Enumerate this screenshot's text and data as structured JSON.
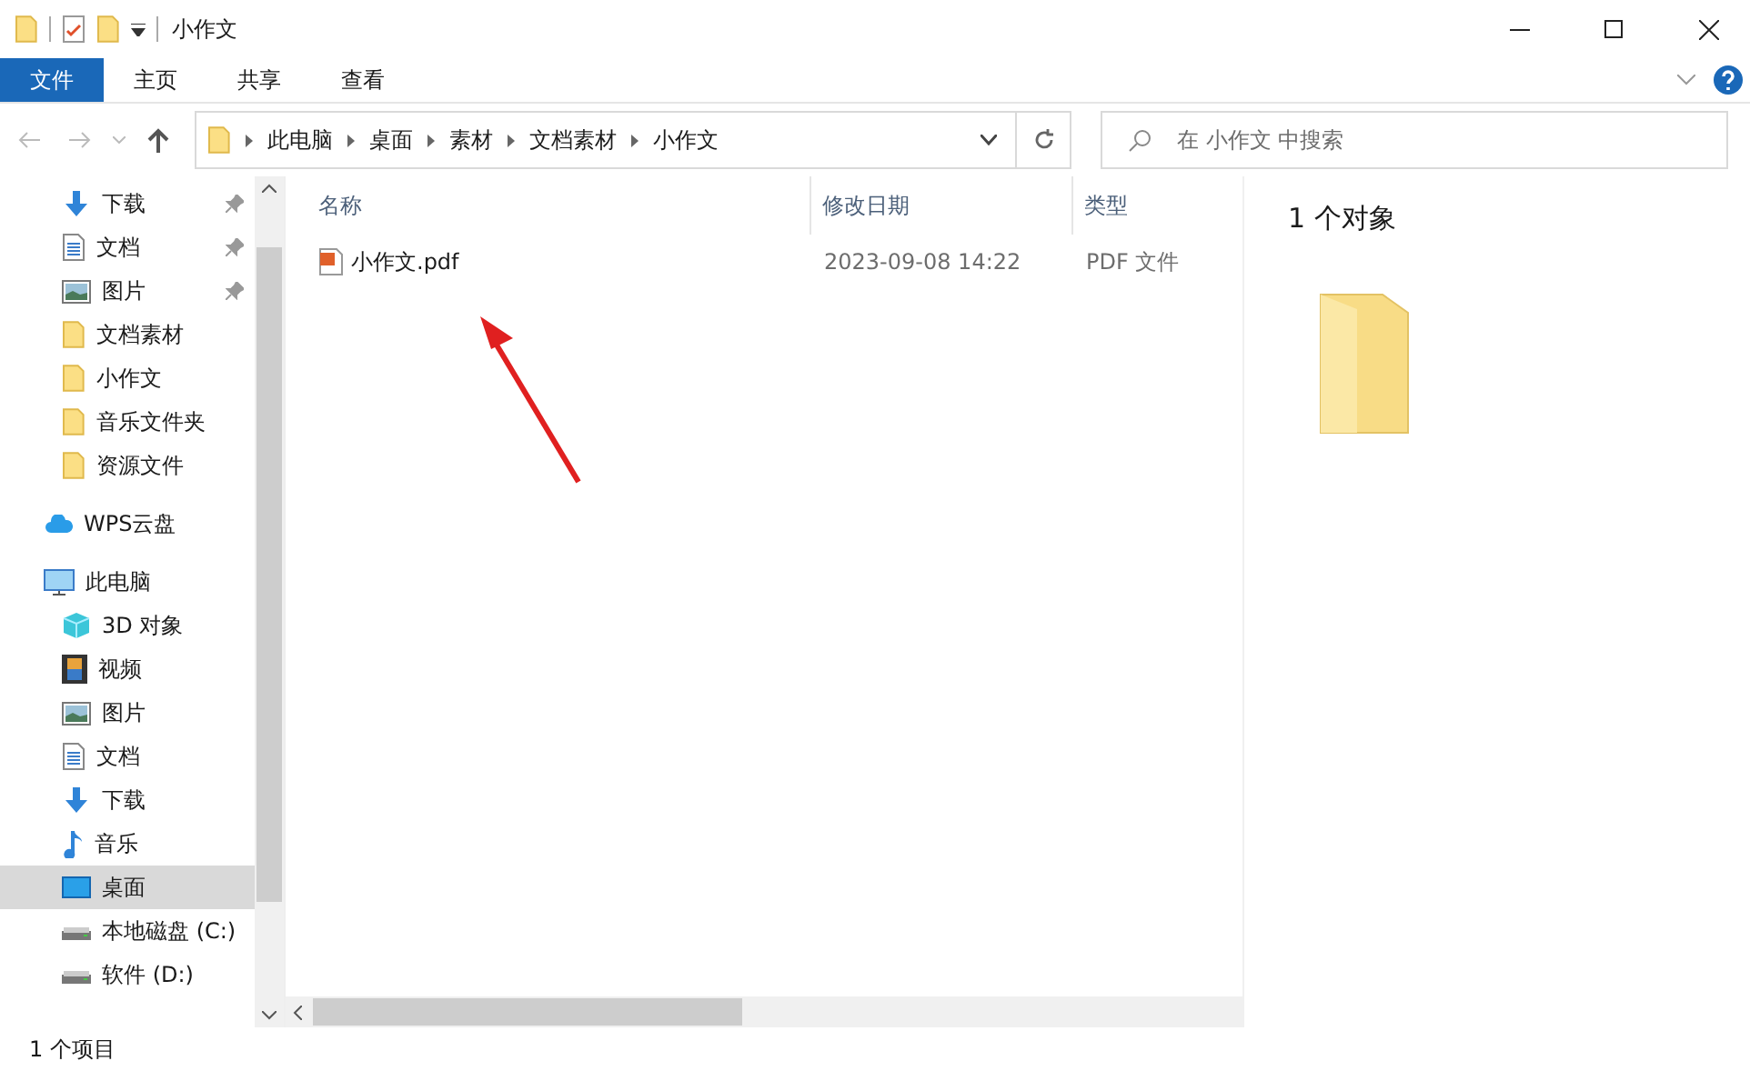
{
  "window": {
    "title": "小作文"
  },
  "ribbon_tabs": [
    {
      "label": "文件",
      "selected": true
    },
    {
      "label": "主页",
      "selected": false
    },
    {
      "label": "共享",
      "selected": false
    },
    {
      "label": "查看",
      "selected": false
    }
  ],
  "address_bar": {
    "crumbs": [
      "此电脑",
      "桌面",
      "素材",
      "文档素材",
      "小作文"
    ]
  },
  "search": {
    "placeholder": "在 小作文 中搜索"
  },
  "sidebar": {
    "items": [
      {
        "label": "下载",
        "kind": "download",
        "pinned": true,
        "selected": false
      },
      {
        "label": "文档",
        "kind": "document",
        "pinned": true,
        "selected": false
      },
      {
        "label": "图片",
        "kind": "picture",
        "pinned": true,
        "selected": false
      },
      {
        "label": "文档素材",
        "kind": "folder",
        "pinned": false,
        "selected": false
      },
      {
        "label": "小作文",
        "kind": "folder",
        "pinned": false,
        "selected": false
      },
      {
        "label": "音乐文件夹",
        "kind": "folder",
        "pinned": false,
        "selected": false
      },
      {
        "label": "资源文件",
        "kind": "folder",
        "pinned": false,
        "selected": false
      },
      {
        "label": "WPS云盘",
        "kind": "cloud",
        "pinned": false,
        "selected": false,
        "top": true
      },
      {
        "label": "此电脑",
        "kind": "pc",
        "pinned": false,
        "selected": false,
        "top": true,
        "children": [
          {
            "label": "3D 对象",
            "kind": "cube",
            "pinned": false,
            "selected": false
          },
          {
            "label": "视频",
            "kind": "video",
            "pinned": false,
            "selected": false
          },
          {
            "label": "图片",
            "kind": "picture",
            "pinned": false,
            "selected": false
          },
          {
            "label": "文档",
            "kind": "document",
            "pinned": false,
            "selected": false
          },
          {
            "label": "下载",
            "kind": "download",
            "pinned": false,
            "selected": false
          },
          {
            "label": "音乐",
            "kind": "music",
            "pinned": false,
            "selected": false
          },
          {
            "label": "桌面",
            "kind": "desktop",
            "pinned": false,
            "selected": true
          },
          {
            "label": "本地磁盘 (C:)",
            "kind": "drive",
            "pinned": false,
            "selected": false
          },
          {
            "label": "软件 (D:)",
            "kind": "drive",
            "pinned": false,
            "selected": false
          }
        ]
      }
    ]
  },
  "table": {
    "columns": [
      "名称",
      "修改日期",
      "类型"
    ],
    "rows": [
      {
        "name": "小作文.pdf",
        "modified": "2023-09-08 14:22",
        "type": "PDF 文件",
        "selected": false
      }
    ]
  },
  "preview": {
    "title": "1 个对象"
  },
  "status_bar": {
    "count": "1 个项目"
  }
}
